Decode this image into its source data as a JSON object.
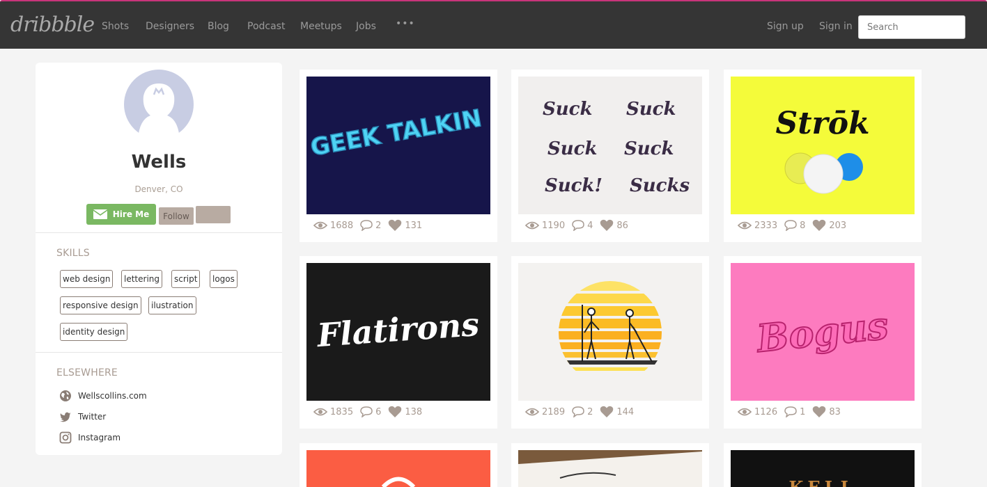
{
  "nav": {
    "logo": "dribbble",
    "items": [
      "Shots",
      "Designers",
      "Blog",
      "Podcast",
      "Meetups",
      "Jobs"
    ],
    "more": "•••",
    "sign_up": "Sign up",
    "sign_in": "Sign in",
    "search_placeholder": "Search"
  },
  "profile": {
    "name": "Wells",
    "location": "Denver, CO",
    "hire_label": "Hire Me",
    "follow_label": "Follow",
    "skills_title": "SKILLS",
    "skills": [
      "web design",
      "lettering",
      "script",
      "logos",
      "responsive design",
      "ilustration",
      "identity design"
    ],
    "elsewhere_title": "ELSEWHERE",
    "links": [
      {
        "label": "Wellscollins.com",
        "icon": "globe-icon"
      },
      {
        "label": "Twitter",
        "icon": "twitter-icon"
      },
      {
        "label": "Instagram",
        "icon": "instagram-icon"
      }
    ]
  },
  "shots": [
    {
      "title": "GEEK TALKIN",
      "views": "1688",
      "comments": "2",
      "likes": "131",
      "bg": "#16154a"
    },
    {
      "title": "Suck lettering",
      "views": "1190",
      "comments": "4",
      "likes": "86",
      "bg": "#f1efee"
    },
    {
      "title": "Strōk",
      "views": "2333",
      "comments": "8",
      "likes": "203",
      "bg": "#f4fb3a"
    },
    {
      "title": "Flatirons",
      "views": "1835",
      "comments": "6",
      "likes": "138",
      "bg": "#1a1a1a"
    },
    {
      "title": "Paddleboard sunset",
      "views": "2189",
      "comments": "2",
      "likes": "144",
      "bg": "#f3f2f0"
    },
    {
      "title": "Bogus",
      "views": "1126",
      "comments": "1",
      "likes": "83",
      "bg": "#fd7bbf"
    },
    {
      "title": "",
      "views": "",
      "comments": "",
      "likes": "",
      "bg": "#fb5d43"
    },
    {
      "title": "",
      "views": "",
      "comments": "",
      "likes": "",
      "bg": "#d9d4cc"
    },
    {
      "title": "KELL",
      "views": "",
      "comments": "",
      "likes": "",
      "bg": "#111111"
    }
  ],
  "colors": {
    "nav_bg": "#353535",
    "hire_green": "#7ab862",
    "muted": "#a89b92"
  }
}
